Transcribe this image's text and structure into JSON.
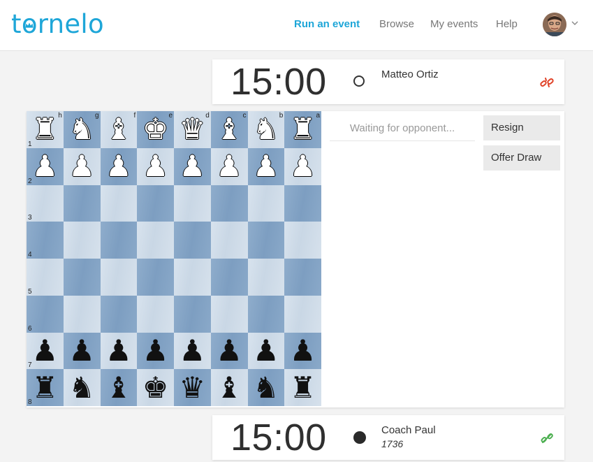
{
  "header": {
    "logo_text": "tornelo",
    "nav": [
      "Run an event",
      "Browse",
      "My events",
      "Help"
    ]
  },
  "opponent": {
    "clock": "15:00",
    "color": "white",
    "name": "Matteo Ortiz",
    "rating": "",
    "connection": "disconnected"
  },
  "player": {
    "clock": "15:00",
    "color": "black",
    "name": "Coach Paul",
    "rating": "1736",
    "connection": "connected"
  },
  "board": {
    "orientation": "black-bottom",
    "files": [
      "h",
      "g",
      "f",
      "e",
      "d",
      "c",
      "b",
      "a"
    ],
    "ranks": [
      "1",
      "2",
      "3",
      "4",
      "5",
      "6",
      "7",
      "8"
    ],
    "rows": [
      [
        "wR",
        "wN",
        "wB",
        "wK",
        "wQ",
        "wB",
        "wN",
        "wR"
      ],
      [
        "wP",
        "wP",
        "wP",
        "wP",
        "wP",
        "wP",
        "wP",
        "wP"
      ],
      [
        "",
        "",
        "",
        "",
        "",
        "",
        "",
        ""
      ],
      [
        "",
        "",
        "",
        "",
        "",
        "",
        "",
        ""
      ],
      [
        "",
        "",
        "",
        "",
        "",
        "",
        "",
        ""
      ],
      [
        "",
        "",
        "",
        "",
        "",
        "",
        "",
        ""
      ],
      [
        "bP",
        "bP",
        "bP",
        "bP",
        "bP",
        "bP",
        "bP",
        "bP"
      ],
      [
        "bR",
        "bN",
        "bB",
        "bK",
        "bQ",
        "bB",
        "bN",
        "bR"
      ]
    ]
  },
  "panel": {
    "waiting_text": "Waiting for opponent...",
    "resign_label": "Resign",
    "offer_draw_label": "Offer Draw"
  },
  "colors": {
    "brand": "#1ea6d8",
    "disconnected": "#e0442a",
    "connected": "#4caf50"
  }
}
